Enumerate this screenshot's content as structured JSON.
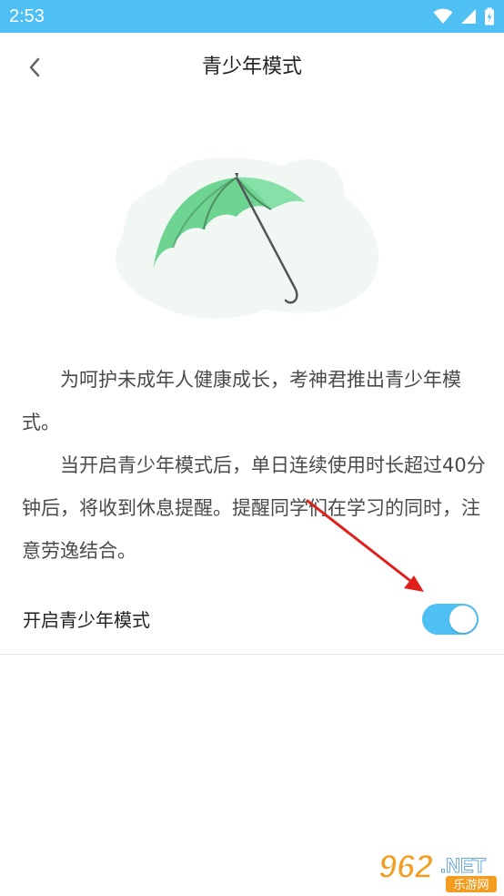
{
  "status_bar": {
    "time": "2:53",
    "icons": [
      "wifi-icon",
      "signal-icon",
      "battery-charging-icon"
    ],
    "background": "#4fc0f3"
  },
  "header": {
    "title": "青少年模式",
    "back_icon": "chevron-left-icon"
  },
  "illustration": {
    "name": "umbrella-icon",
    "color": "#6dd492"
  },
  "description": {
    "paragraphs": [
      "为呵护未成年人健康成长，考神君推出青少年模式。",
      "当开启青少年模式后，单日连续使用时长超过40分钟后，将收到休息提醒。提醒同学们在学习的同时，注意劳逸结合。"
    ]
  },
  "setting": {
    "label": "开启青少年模式",
    "enabled": true,
    "accent": "#4fc0f3"
  },
  "annotation": {
    "arrow_color": "#e0201b"
  },
  "watermark": {
    "number": "962",
    "suffix": ".NET",
    "caption": "乐游网"
  }
}
